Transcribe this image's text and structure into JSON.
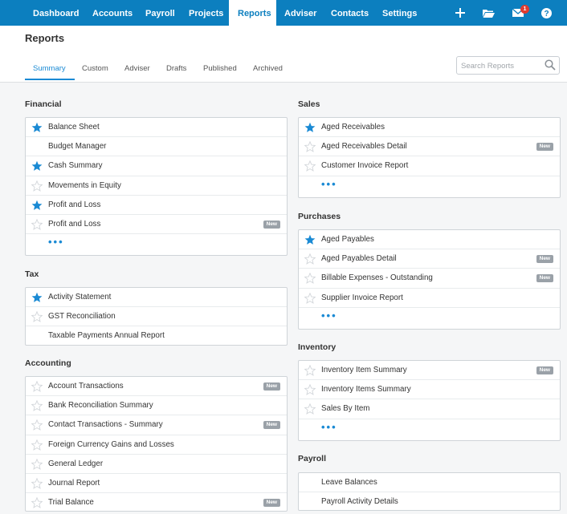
{
  "nav": {
    "items": [
      "Dashboard",
      "Accounts",
      "Payroll",
      "Projects",
      "Reports",
      "Adviser",
      "Contacts",
      "Settings"
    ],
    "active": "Reports",
    "mail_badge": "1",
    "icons": [
      "plus-icon",
      "folder-icon",
      "mail-icon",
      "help-icon"
    ]
  },
  "page": {
    "title": "Reports"
  },
  "tabs": [
    "Summary",
    "Custom",
    "Adviser",
    "Drafts",
    "Published",
    "Archived"
  ],
  "search": {
    "placeholder": "Search Reports"
  },
  "new_label": "New",
  "colors": {
    "nav": "#0c7fbf",
    "accent": "#1a8ad4",
    "highlight": "#f7f70a"
  },
  "sections": {
    "financial": {
      "title": "Financial",
      "items": [
        {
          "label": "Balance Sheet",
          "star": "filled"
        },
        {
          "label": "Budget Manager",
          "star": "none"
        },
        {
          "label": "Cash Summary",
          "star": "filled"
        },
        {
          "label": "Movements in Equity",
          "star": "empty"
        },
        {
          "label": "Profit and Loss",
          "star": "filled"
        },
        {
          "label": "Profit and Loss",
          "star": "empty",
          "new": true
        }
      ]
    },
    "tax": {
      "title": "Tax",
      "items": [
        {
          "label": "Activity Statement",
          "star": "filled"
        },
        {
          "label": "GST Reconciliation",
          "star": "empty"
        },
        {
          "label": "Taxable Payments Annual Report",
          "star": "none"
        }
      ]
    },
    "accounting": {
      "title": "Accounting",
      "items": [
        {
          "label": "Account Transactions",
          "star": "empty",
          "new": true
        },
        {
          "label": "Bank Reconciliation Summary",
          "star": "empty"
        },
        {
          "label": "Contact Transactions - Summary",
          "star": "empty",
          "new": true
        },
        {
          "label": "Foreign Currency Gains and Losses",
          "star": "empty"
        },
        {
          "label": "General Ledger",
          "star": "empty"
        },
        {
          "label": "Journal Report",
          "star": "empty"
        },
        {
          "label": "Trial Balance",
          "star": "empty",
          "new": true
        }
      ]
    },
    "sales": {
      "title": "Sales",
      "items": [
        {
          "label": "Aged Receivables",
          "star": "filled"
        },
        {
          "label": "Aged Receivables Detail",
          "star": "empty",
          "new": true
        },
        {
          "label": "Customer Invoice Report",
          "star": "empty"
        }
      ]
    },
    "purchases": {
      "title": "Purchases",
      "items": [
        {
          "label": "Aged Payables",
          "star": "filled"
        },
        {
          "label": "Aged Payables Detail",
          "star": "empty",
          "new": true
        },
        {
          "label": "Billable Expenses - Outstanding",
          "star": "empty",
          "new": true
        },
        {
          "label": "Supplier Invoice Report",
          "star": "empty"
        }
      ]
    },
    "inventory": {
      "title": "Inventory",
      "items": [
        {
          "label": "Inventory Item Summary",
          "star": "empty",
          "new": true
        },
        {
          "label": "Inventory Items Summary",
          "star": "empty"
        },
        {
          "label": "Sales By Item",
          "star": "empty"
        }
      ]
    },
    "payroll": {
      "title": "Payroll",
      "items": [
        {
          "label": "Leave Balances",
          "star": "none"
        },
        {
          "label": "Payroll Activity Details",
          "star": "none"
        }
      ]
    }
  }
}
